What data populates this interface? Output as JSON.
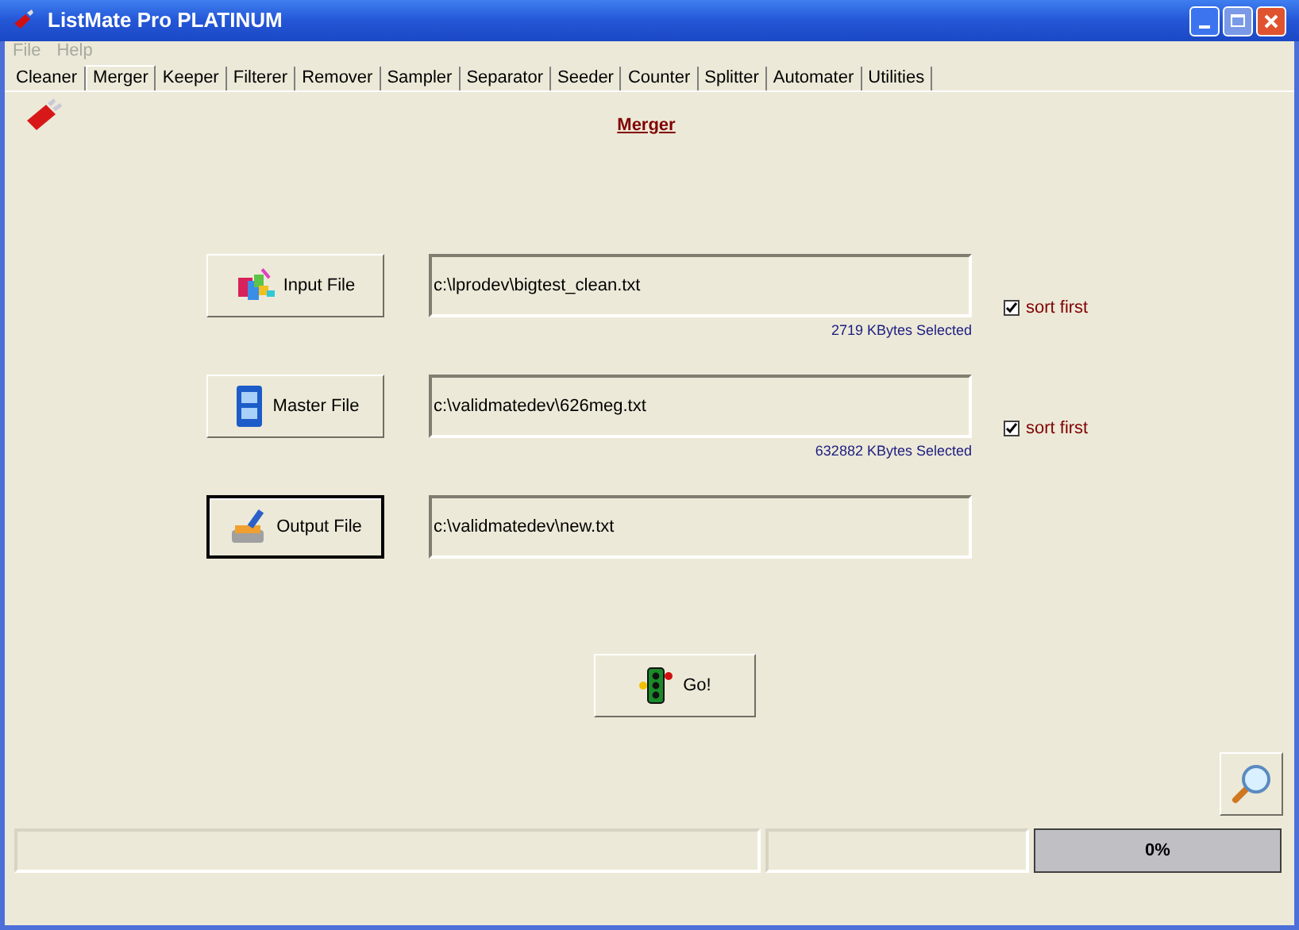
{
  "window": {
    "title": "ListMate Pro PLATINUM"
  },
  "menu": [
    {
      "label": "File",
      "disabled": true
    },
    {
      "label": "Help",
      "disabled": true
    }
  ],
  "tabs": [
    {
      "label": "Cleaner",
      "selected": false
    },
    {
      "label": "Merger",
      "selected": true
    },
    {
      "label": "Keeper",
      "selected": false
    },
    {
      "label": "Filterer",
      "selected": false
    },
    {
      "label": "Remover",
      "selected": false
    },
    {
      "label": "Sampler",
      "selected": false
    },
    {
      "label": "Separator",
      "selected": false
    },
    {
      "label": "Seeder",
      "selected": false
    },
    {
      "label": "Counter",
      "selected": false
    },
    {
      "label": "Splitter",
      "selected": false
    },
    {
      "label": "Automater",
      "selected": false
    },
    {
      "label": "Utilities",
      "selected": false
    }
  ],
  "heading": "Merger",
  "files": [
    {
      "kind": "input",
      "button": "Input File",
      "default": false,
      "path": "c:\\lprodev\\bigtest_clean.txt",
      "size_note": "2719 KBytes Selected",
      "sort_first": {
        "label": "sort first",
        "checked": true
      }
    },
    {
      "kind": "master",
      "button": "Master File",
      "default": false,
      "path": "c:\\validmatedev\\626meg.txt",
      "size_note": "632882 KBytes Selected",
      "sort_first": {
        "label": "sort first",
        "checked": true
      }
    },
    {
      "kind": "output",
      "button": "Output File",
      "default": true,
      "path": "c:\\validmatedev\\new.txt"
    }
  ],
  "go_button": "Go!",
  "progress": {
    "level": 0,
    "reading": "0%"
  }
}
